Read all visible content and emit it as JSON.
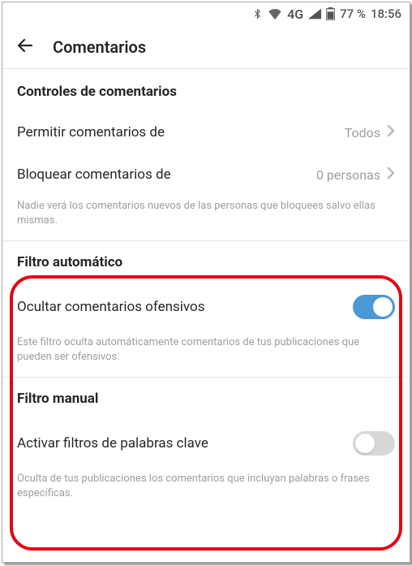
{
  "status": {
    "bluetooth": "bluetooth-icon",
    "wifi": "wifi-icon",
    "network_label": "4G",
    "signal": "signal-icon",
    "battery": "battery-icon",
    "battery_pct": "77 %",
    "time": "18:56"
  },
  "header": {
    "back_icon": "arrow-left-icon",
    "title": "Comentarios"
  },
  "section1": {
    "title": "Controles de comentarios",
    "row_allow": {
      "label": "Permitir comentarios de",
      "value": "Todos"
    },
    "row_block": {
      "label": "Bloquear comentarios de",
      "value": "0 personas"
    },
    "helper": "Nadie verá los comentarios nuevos de las personas que bloquees salvo ellas mismas."
  },
  "section2": {
    "title": "Filtro automático",
    "row_hide": {
      "label": "Ocultar comentarios ofensivos",
      "on": true
    },
    "helper": "Este filtro oculta automáticamente comentarios de tus publicaciones que pueden ser ofensivos."
  },
  "section3": {
    "title": "Filtro manual",
    "row_keyword": {
      "label": "Activar filtros de palabras clave",
      "on": false
    },
    "helper": "Oculta de tus publicaciones los comentarios que incluyan palabras o frases específicas."
  }
}
